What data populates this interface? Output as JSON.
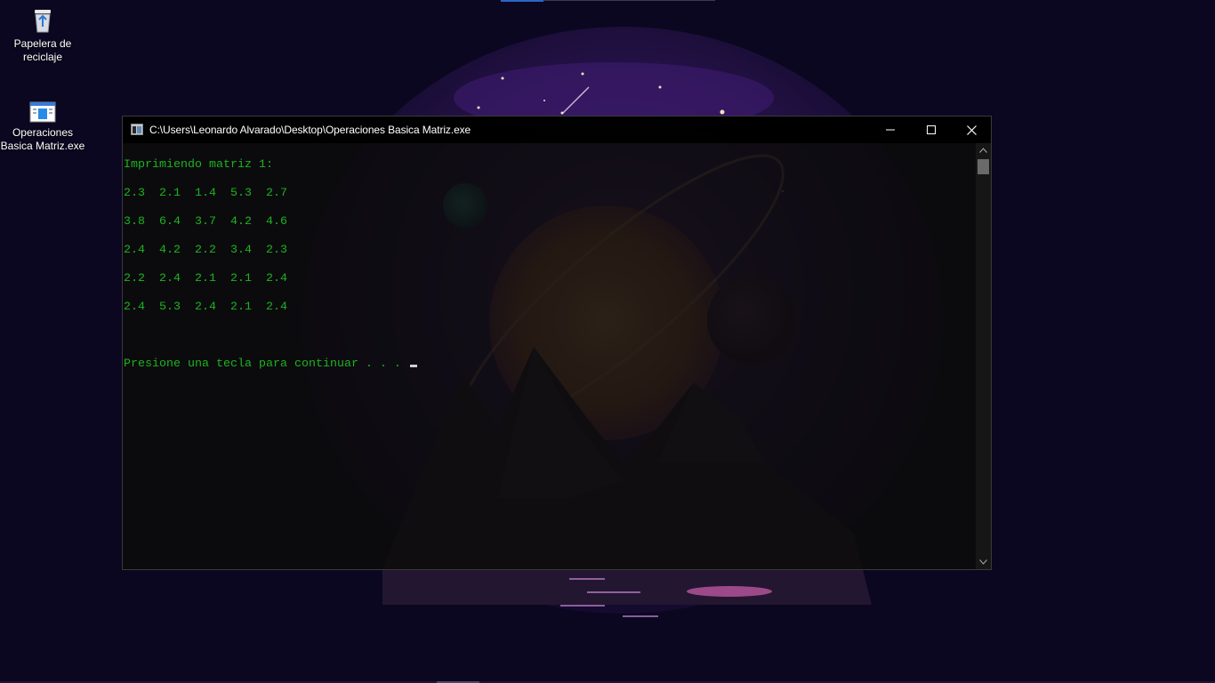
{
  "desktop": {
    "icons": [
      {
        "label_line1": "Papelera de",
        "label_line2": "reciclaje"
      },
      {
        "label_line1": "Operaciones",
        "label_line2": "Basica Matriz.exe"
      }
    ]
  },
  "console": {
    "title": "C:\\Users\\Leonardo Alvarado\\Desktop\\Operaciones Basica Matriz.exe",
    "text_color": "#1db31d",
    "heading": "Imprimiendo matriz 1:",
    "rows": [
      "2.3  2.1  1.4  5.3  2.7",
      "3.8  6.4  3.7  4.2  4.6",
      "2.4  4.2  2.2  3.4  2.3",
      "2.2  2.4  2.1  2.1  2.4",
      "2.4  5.3  2.4  2.1  2.4"
    ],
    "prompt": "Presione una tecla para continuar . . . ",
    "controls": {
      "minimize": "minimize-icon",
      "maximize": "maximize-icon",
      "close": "close-icon"
    }
  }
}
